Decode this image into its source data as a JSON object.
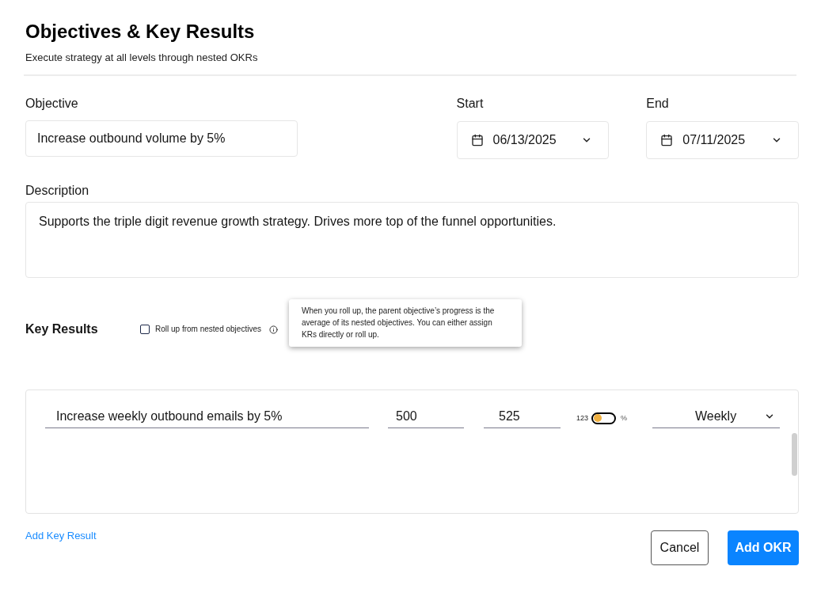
{
  "header": {
    "title": "Objectives & Key Results",
    "subtitle": "Execute strategy at all levels through nested OKRs"
  },
  "objective": {
    "label": "Objective",
    "value": "Increase outbound volume by 5%"
  },
  "dates": [
    {
      "label": "Start",
      "value": "06/13/2025"
    },
    {
      "label": "End",
      "value": "07/11/2025"
    }
  ],
  "description": {
    "label": "Description",
    "value": "Supports the triple digit revenue growth strategy. Drives more top of the funnel opportunities."
  },
  "key_results": {
    "title": "Key Results",
    "rollup": {
      "label": "Roll up from nested objectives",
      "checked": false
    },
    "tooltip": "When you roll up, the parent objective’s progress is the average of its nested objectives. You can either assign KRs directly or roll up.",
    "rows": [
      {
        "name": "Increase weekly outbound emails by 5%",
        "start_value": "500",
        "target_value": "525",
        "unit_toggle": {
          "off_label": "123",
          "on_label": "%",
          "on": false
        },
        "frequency": "Weekly"
      }
    ],
    "add_link": "Add Key Result"
  },
  "buttons": [
    {
      "label": "Cancel",
      "kind": "secondary"
    },
    {
      "label": "Add OKR",
      "kind": "primary"
    }
  ]
}
